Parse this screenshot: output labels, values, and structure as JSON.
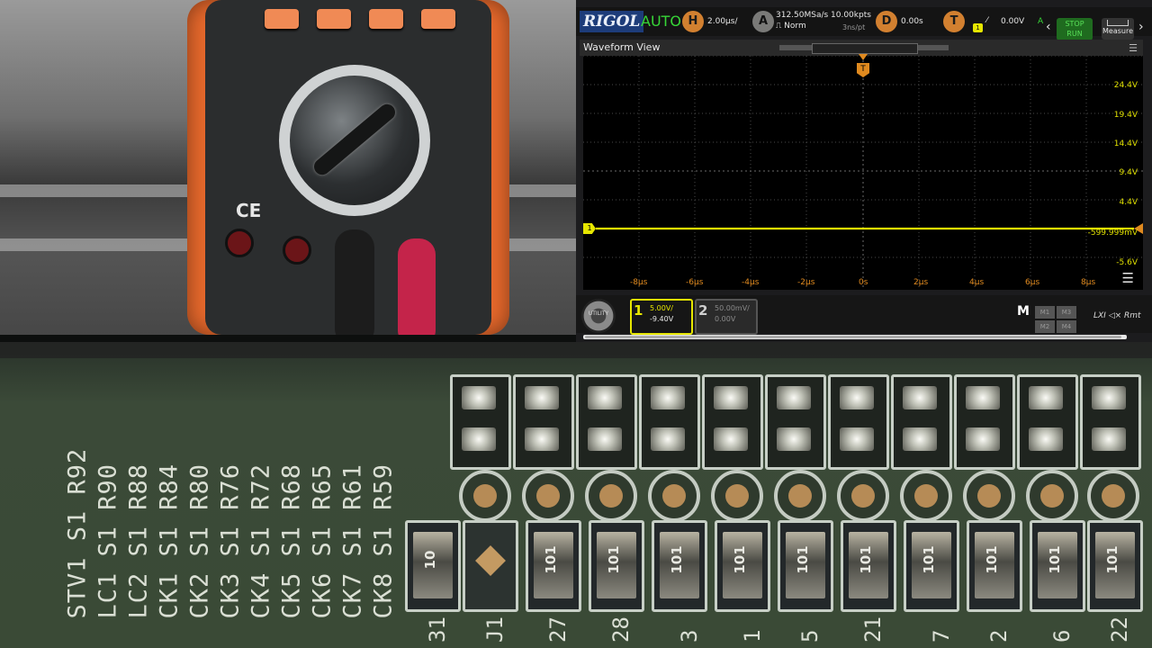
{
  "scope": {
    "brand": "RIGOL",
    "mode": "AUTO",
    "horizontal": {
      "label": "H",
      "timebase": "2.00μs/"
    },
    "acquire": {
      "label": "A",
      "sample_rate": "312.50MSa/s",
      "mem_depth": "10.00kpts",
      "acq_mode": "Norm",
      "pt_time": "3ns/pt"
    },
    "delay": {
      "label": "D",
      "value": "0.00s"
    },
    "trigger": {
      "label": "T",
      "source": "1",
      "level": "0.00V",
      "coupling": "A"
    },
    "stop_run": {
      "line1": "STOP",
      "line2": "RUN"
    },
    "measure_label": "Measure",
    "view_title": "Waveform View",
    "volt_labels": [
      "24.4V",
      "19.4V",
      "14.4V",
      "9.4V",
      "4.4V",
      "-599.999mV",
      "-5.6V"
    ],
    "time_labels": [
      "-8μs",
      "-6μs",
      "-4μs",
      "-2μs",
      "0s",
      "2μs",
      "4μs",
      "6μs",
      "8μs"
    ],
    "trigger_marker": "T",
    "channel_marker": "1",
    "utility_label": "UTILITY",
    "ch1": {
      "num": "1",
      "scale": "5.00V/",
      "offset": "-9.40V"
    },
    "ch2": {
      "num": "2",
      "scale": "50.00mV/",
      "offset": "0.00V"
    },
    "math": {
      "label": "M",
      "slots": [
        "M1",
        "M3",
        "M2",
        "M4"
      ]
    },
    "lxi_label": "LXI  ◁× Rmt"
  },
  "pcb": {
    "silk_labels": [
      "STV1 S1 R92",
      "LC1 S1 R90",
      "LC2 S1 R88",
      "CK1 S1 R84",
      "CK2 S1 R80",
      "CK3 S1 R76",
      "CK4 S1 R72",
      "CK5 S1 R68",
      "CK6 S1 R65",
      "CK7 S1 R61",
      "CK8 S1 R59"
    ],
    "resistor_codes": [
      "10",
      "",
      "101",
      "101",
      "101",
      "101",
      "101",
      "101",
      "101",
      "101",
      "101",
      "101"
    ],
    "ref_fragments": [
      "31",
      "J1",
      "27",
      "28",
      "3",
      "1",
      "5",
      "21",
      "7",
      "2",
      "6",
      "22"
    ]
  },
  "meter": {
    "ce_mark": "CE"
  },
  "colors": {
    "ch1": "#e6e600",
    "trigger": "#e08a1f",
    "grid": "#4a4a4a"
  }
}
